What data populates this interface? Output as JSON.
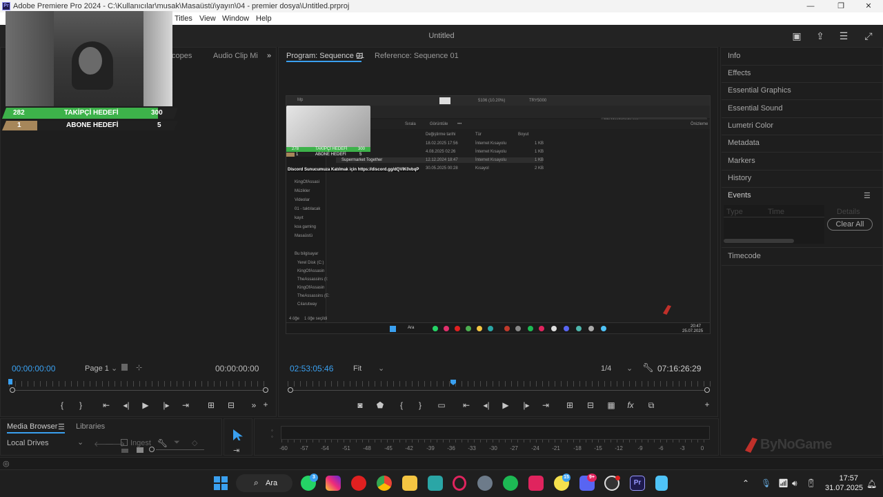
{
  "window": {
    "title": "Adobe Premiere Pro 2024 - C:\\Kullanıcılar\\musak\\Masaüstü\\yayın\\04 - premier dosya\\Untitled.prproj",
    "logo": "Pr",
    "minimize": "—",
    "maximize": "❐",
    "close": "✕"
  },
  "menu": {
    "items": [
      "Titles",
      "View",
      "Window",
      "Help"
    ]
  },
  "header": {
    "doc_title": "Untitled"
  },
  "source_panel": {
    "tabs": [
      "copes",
      "Audio Clip Mi"
    ],
    "expand": "»",
    "timecode_left": "00:00:00:00",
    "page": "Page 1",
    "timecode_right": "00:00:00:00"
  },
  "program_panel": {
    "tab_program": "Program: Sequence 01",
    "tab_reference": "Reference: Sequence 01",
    "timecode": "02:53:05:46",
    "fit": "Fit",
    "resolution": "1/4",
    "duration": "07:16:26:29"
  },
  "stream_overlay": {
    "follower_goal": {
      "current": "282",
      "label": "TAKİPÇİ HEDEFİ",
      "target": "300",
      "progress": 0.94
    },
    "sub_goal": {
      "current": "1",
      "label": "ABONE HEDEFİ",
      "target": "5",
      "progress": 0.2
    }
  },
  "monitor_content": {
    "tab_label": "Mp",
    "zoom_text": "5106 (10.20%)",
    "res_text": "TRY5000",
    "path": "Mp",
    "search_placeholder": "Mp klasöründe ara",
    "toolbar": [
      "Sırala",
      "Görüntüle",
      "•••"
    ],
    "details": "Önizleme",
    "col_headers": [
      "Değiştirme tarihi",
      "Tür",
      "Boyut"
    ],
    "rows": [
      {
        "name": "",
        "date": "18.02.2025 17:56",
        "type": "İnternet Kısayolu",
        "size": "1 KB"
      },
      {
        "name": "",
        "date": "4.08.2025 02:26",
        "type": "İnternet Kısayolu",
        "size": "1 KB"
      },
      {
        "name": "Supermarket Together",
        "date": "12.12.2024 18:47",
        "type": "İnternet Kısayolu",
        "size": "1 KB"
      },
      {
        "name": "",
        "date": "30.05.2025 00:28",
        "type": "Kısayol",
        "size": "2 KB"
      }
    ],
    "discord_note": "Discord Sunucumuza Katılmak için https://discord.gg/dQVIK0vbqP",
    "sidebar": [
      "KingOfAssasi",
      "Müzikler",
      "Videolar",
      "01 - taktılacak",
      "kayıt",
      "koa gaming",
      "Masaüstü",
      "Bu bilgisayar",
      "Yerel Disk (C:)",
      "KingOfAssasin",
      "TheAssassins (I:",
      "KingOfAssasin",
      "TheAssassins (E:",
      "Cılarutway"
    ],
    "status": "1 öğe seçildi",
    "items_count": "4 öğe",
    "clock": "20:47",
    "date": "25.07.2025",
    "search_label": "Ara",
    "mini_goal_1": {
      "current": "278",
      "label": "TAKİPÇİ HEDEFİ",
      "target": "300"
    },
    "mini_goal_2": {
      "current": "1",
      "label": "ABONE HEDEFİ",
      "target": "5"
    }
  },
  "right_panel": {
    "items": [
      "Info",
      "Effects",
      "Essential Graphics",
      "Essential Sound",
      "Lumetri Color",
      "Metadata",
      "Markers",
      "History",
      "Events",
      "Timecode"
    ],
    "events": {
      "col_type": "Type",
      "col_time": "Time",
      "col_details": "Details",
      "clear_all": "Clear All"
    }
  },
  "bottom_left": {
    "tab_media_browser": "Media Browser",
    "tab_libraries": "Libraries",
    "drive": "Local Drives",
    "ingest": "Ingest"
  },
  "timeline": {
    "ruler": [
      "-60",
      "-57",
      "-54",
      "-51",
      "-48",
      "-45",
      "-42",
      "-39",
      "-36",
      "-33",
      "-30",
      "-27",
      "-24",
      "-21",
      "-18",
      "-15",
      "-12",
      "-9",
      "-6",
      "-3",
      "0"
    ]
  },
  "watermark": {
    "text": "ByNoGame"
  },
  "taskbar": {
    "search": "Ara",
    "badges": {
      "whatsapp": "3",
      "uplay": "15",
      "discord": "9+"
    },
    "time": "17:57",
    "date": "31.07.2025"
  },
  "colors": {
    "accent_blue": "#3aa0f0",
    "goal_green": "#3db24a",
    "goal_tan": "#a6865a",
    "premiere_bg": "#1d1d1d"
  }
}
